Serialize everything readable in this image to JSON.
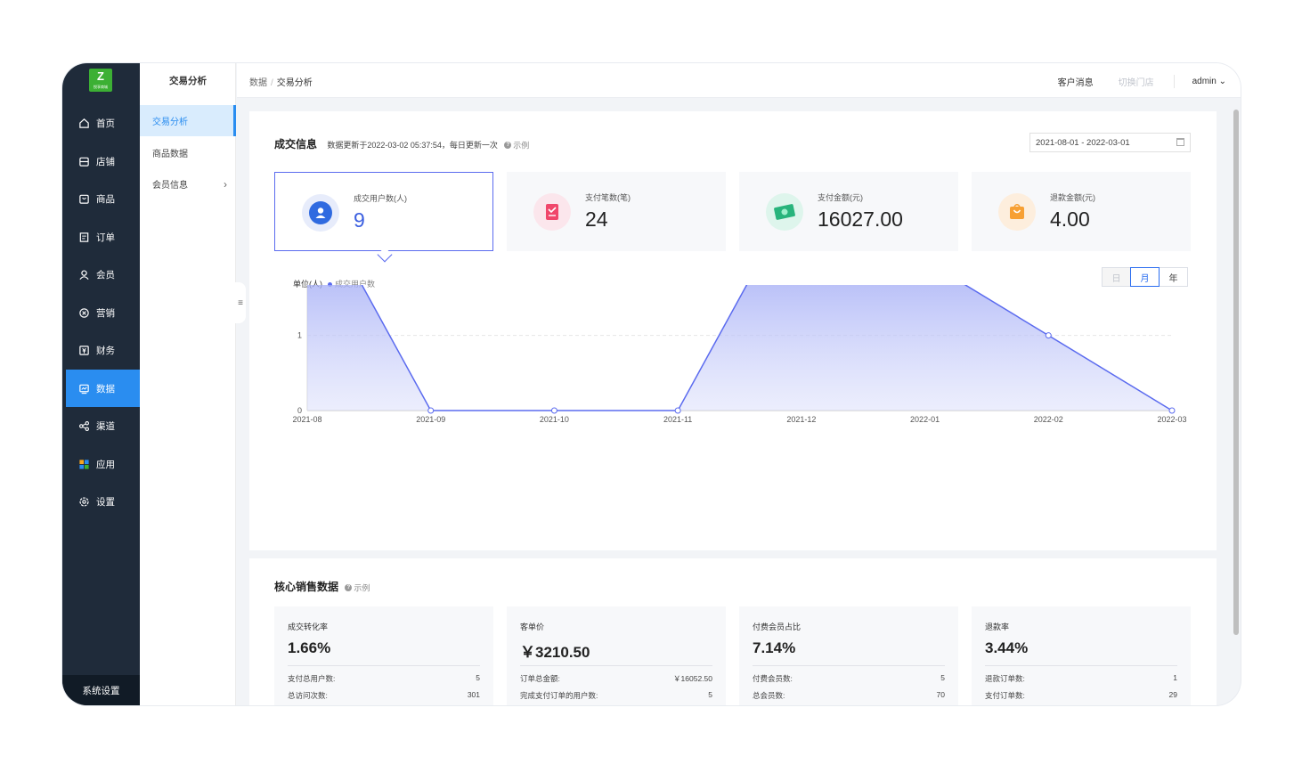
{
  "logo": {
    "glyph": "Z",
    "text": "悦享商城"
  },
  "nav": {
    "items": [
      {
        "label": "首页",
        "icon": "home-icon"
      },
      {
        "label": "店铺",
        "icon": "store-icon"
      },
      {
        "label": "商品",
        "icon": "bag-icon"
      },
      {
        "label": "订单",
        "icon": "order-icon"
      },
      {
        "label": "会员",
        "icon": "user-icon"
      },
      {
        "label": "营销",
        "icon": "marketing-icon"
      },
      {
        "label": "财务",
        "icon": "finance-icon"
      },
      {
        "label": "数据",
        "icon": "chart-icon",
        "active": true
      },
      {
        "label": "渠道",
        "icon": "share-icon"
      },
      {
        "label": "应用",
        "icon": "apps-icon"
      },
      {
        "label": "设置",
        "icon": "gear-icon"
      }
    ],
    "system": "系统设置"
  },
  "submenu": {
    "title": "交易分析",
    "items": [
      "交易分析",
      "商品数据",
      "会员信息"
    ]
  },
  "topbar": {
    "breadcrumb": [
      "数据",
      "交易分析"
    ],
    "messages": "客户消息",
    "switch_store": "切换门店",
    "user": "admin"
  },
  "deal": {
    "title": "成交信息",
    "note": "数据更新于2022-03-02 05:37:54，每日更新一次",
    "example": "示例",
    "date_range": "2021-08-01 - 2022-03-01",
    "stats": [
      {
        "label": "成交用户数(人)",
        "value": "9"
      },
      {
        "label": "支付笔数(笔)",
        "value": "24"
      },
      {
        "label": "支付金额(元)",
        "value": "16027.00"
      },
      {
        "label": "退款金额(元)",
        "value": "4.00"
      }
    ],
    "unit": "单位(人)",
    "series_name": "成交用户数",
    "segments": [
      "日",
      "月",
      "年"
    ]
  },
  "core": {
    "title": "核心销售数据",
    "example": "示例",
    "metrics": [
      {
        "title": "成交转化率",
        "value": "1.66%",
        "rows": [
          [
            "支付总用户数:",
            "5"
          ],
          [
            "总访问次数:",
            "301"
          ]
        ]
      },
      {
        "title": "客单价",
        "value": "￥3210.50",
        "rows": [
          [
            "订单总金额:",
            "￥16052.50"
          ],
          [
            "完成支付订单的用户数:",
            "5"
          ]
        ]
      },
      {
        "title": "付费会员占比",
        "value": "7.14%",
        "rows": [
          [
            "付费会员数:",
            "5"
          ],
          [
            "总会员数:",
            "70"
          ]
        ]
      },
      {
        "title": "退款率",
        "value": "3.44%",
        "rows": [
          [
            "退款订单数:",
            "1"
          ],
          [
            "支付订单数:",
            "29"
          ]
        ]
      }
    ]
  },
  "colors": {
    "accent": "#2a8df0",
    "series": "#5b6bef",
    "sidebar": "#1f2b3a"
  },
  "chart_data": {
    "type": "area",
    "x": [
      "2021-08",
      "2021-09",
      "2021-10",
      "2021-11",
      "2021-12",
      "2022-01",
      "2022-02",
      "2022-03"
    ],
    "series": [
      {
        "name": "成交用户数",
        "values": [
          3,
          0,
          0,
          0,
          3,
          2,
          1,
          0
        ]
      }
    ],
    "ylabel": "单位(人)",
    "yticks": [
      0,
      1,
      2,
      3
    ],
    "ylim": [
      0,
      3
    ],
    "grid": true,
    "legend": "top-left"
  }
}
